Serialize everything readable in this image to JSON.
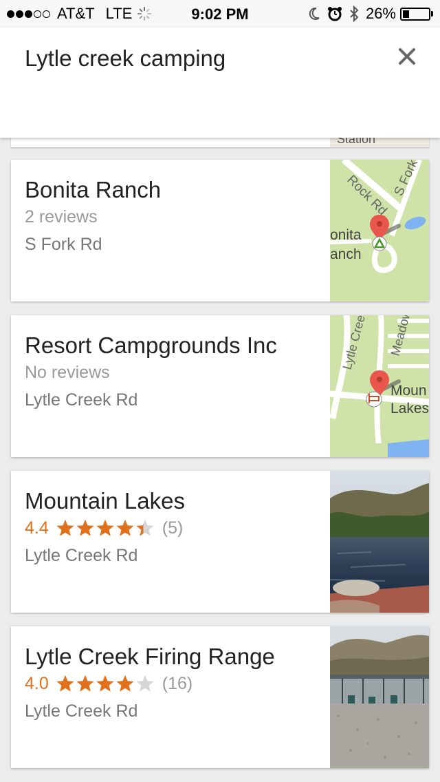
{
  "status_bar": {
    "carrier": "AT&T",
    "network": "LTE",
    "time": "9:02 PM",
    "battery": "26%",
    "battery_level": 0.26,
    "signal_bars_filled": 3,
    "signal_bars_total": 5
  },
  "search": {
    "query": "Lytle creek camping",
    "close_icon": "close-icon"
  },
  "peek_card": {
    "map_label": "Station"
  },
  "results": [
    {
      "title": "Bonita Ranch",
      "reviews": "2 reviews",
      "address": "S Fork Rd",
      "thumb": "map",
      "map_labels": [
        "Rock Rd",
        "S Fork",
        "onita",
        "anch"
      ],
      "marker_icon": "campground-icon"
    },
    {
      "title": "Resort Campgrounds Inc",
      "reviews": "No reviews",
      "address": "Lytle Creek Rd",
      "thumb": "map",
      "map_labels": [
        "Lytle Cree",
        "Meadow",
        "Moun",
        "Lakes"
      ],
      "marker_icon": "lodging-icon"
    },
    {
      "title": "Mountain Lakes",
      "rating": "4.4",
      "stars": 4.4,
      "review_count": "(5)",
      "address": "Lytle Creek Rd",
      "thumb": "photo-lake"
    },
    {
      "title": "Lytle Creek Firing Range",
      "rating": "4.0",
      "stars": 4.0,
      "review_count": "(16)",
      "address": "Lytle Creek Rd",
      "thumb": "photo-range"
    }
  ],
  "colors": {
    "rating_orange": "#e0701b",
    "star_empty": "#d6d6d6",
    "map_green": "#cfe3a8",
    "map_water": "#7fb2f0",
    "marker_red": "#e8564e"
  }
}
